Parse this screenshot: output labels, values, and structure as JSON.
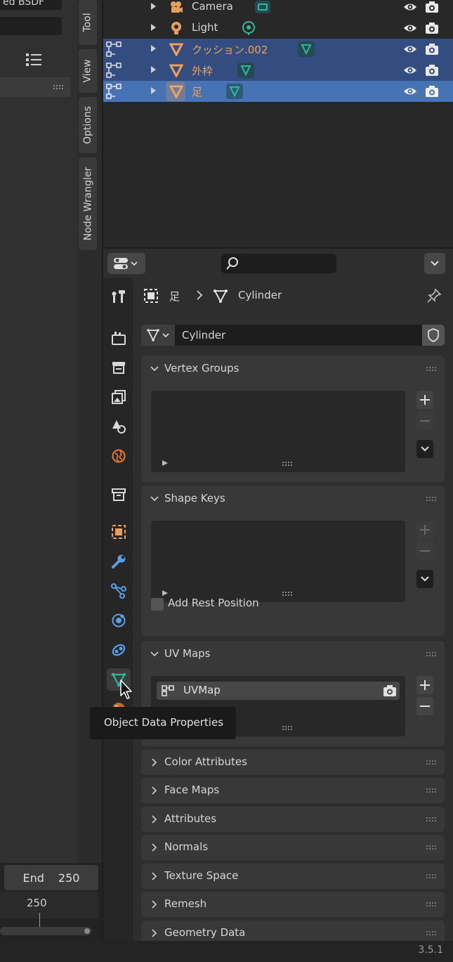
{
  "node_editor": {
    "node_label": "ed BSDF",
    "side_tabs": [
      "Tool",
      "View",
      "Options",
      "Node Wrangler"
    ]
  },
  "timeline": {
    "end_label": "End",
    "end_value": "250",
    "current_frame": "250"
  },
  "outliner": {
    "rows": [
      {
        "name": "Camera",
        "type": "camera",
        "state": "normal"
      },
      {
        "name": "Light",
        "type": "light",
        "state": "normal"
      },
      {
        "name": "クッション.002",
        "type": "mesh",
        "state": "selected"
      },
      {
        "name": "外枠",
        "type": "mesh",
        "state": "selected"
      },
      {
        "name": "足",
        "type": "mesh",
        "state": "active"
      }
    ]
  },
  "properties": {
    "breadcrumb": {
      "object": "足",
      "data": "Cylinder"
    },
    "mesh_name": "Cylinder",
    "panels": {
      "vertex_groups": "Vertex Groups",
      "shape_keys": "Shape Keys",
      "add_rest_position": "Add Rest Position",
      "uv_maps": "UV Maps",
      "uv_map_item": "UVMap"
    },
    "collapsed_panels": [
      "Color Attributes",
      "Face Maps",
      "Attributes",
      "Normals",
      "Texture Space",
      "Remesh",
      "Geometry Data"
    ]
  },
  "tooltip": "Object Data Properties",
  "status": {
    "version": "3.5.1"
  },
  "colors": {
    "accent_orange": "#f0a05a",
    "data_green": "#2fb89a",
    "selection_blue": "#334d80",
    "active_blue": "#4772b3"
  }
}
